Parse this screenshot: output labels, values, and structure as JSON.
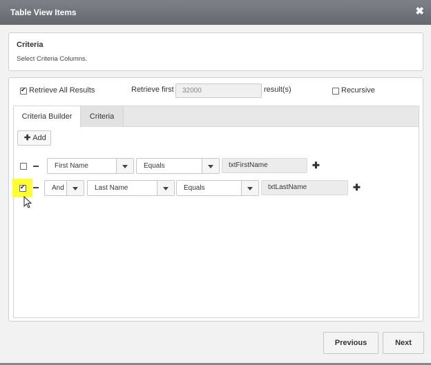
{
  "dialog": {
    "title": "Table View Items",
    "close_glyph": "✖"
  },
  "criteria_header": {
    "title": "Criteria",
    "subtitle": "Select Criteria Columns."
  },
  "options": {
    "retrieve_all_label": "Retrieve All Results",
    "retrieve_all_checked": true,
    "retrieve_first_label": "Retrieve first",
    "retrieve_first_value": "32000",
    "results_suffix": "result(s)",
    "recursive_label": "Recursive",
    "recursive_checked": false
  },
  "tabs": [
    {
      "label": "Criteria Builder",
      "active": true
    },
    {
      "label": "Criteria",
      "active": false
    }
  ],
  "builder": {
    "add_label": "Add",
    "rows": [
      {
        "checked": false,
        "conjunction": "",
        "field": "First Name",
        "operator": "Equals",
        "value": "txtFirstName"
      },
      {
        "checked": true,
        "conjunction": "And",
        "field": "Last Name",
        "operator": "Equals",
        "value": "txtLastName"
      }
    ]
  },
  "footer": {
    "previous_label": "Previous",
    "next_label": "Next"
  },
  "colors": {
    "titlebar": "#6e7278",
    "highlight": "#ffff33",
    "dialog_bg": "#f2f2f2"
  }
}
